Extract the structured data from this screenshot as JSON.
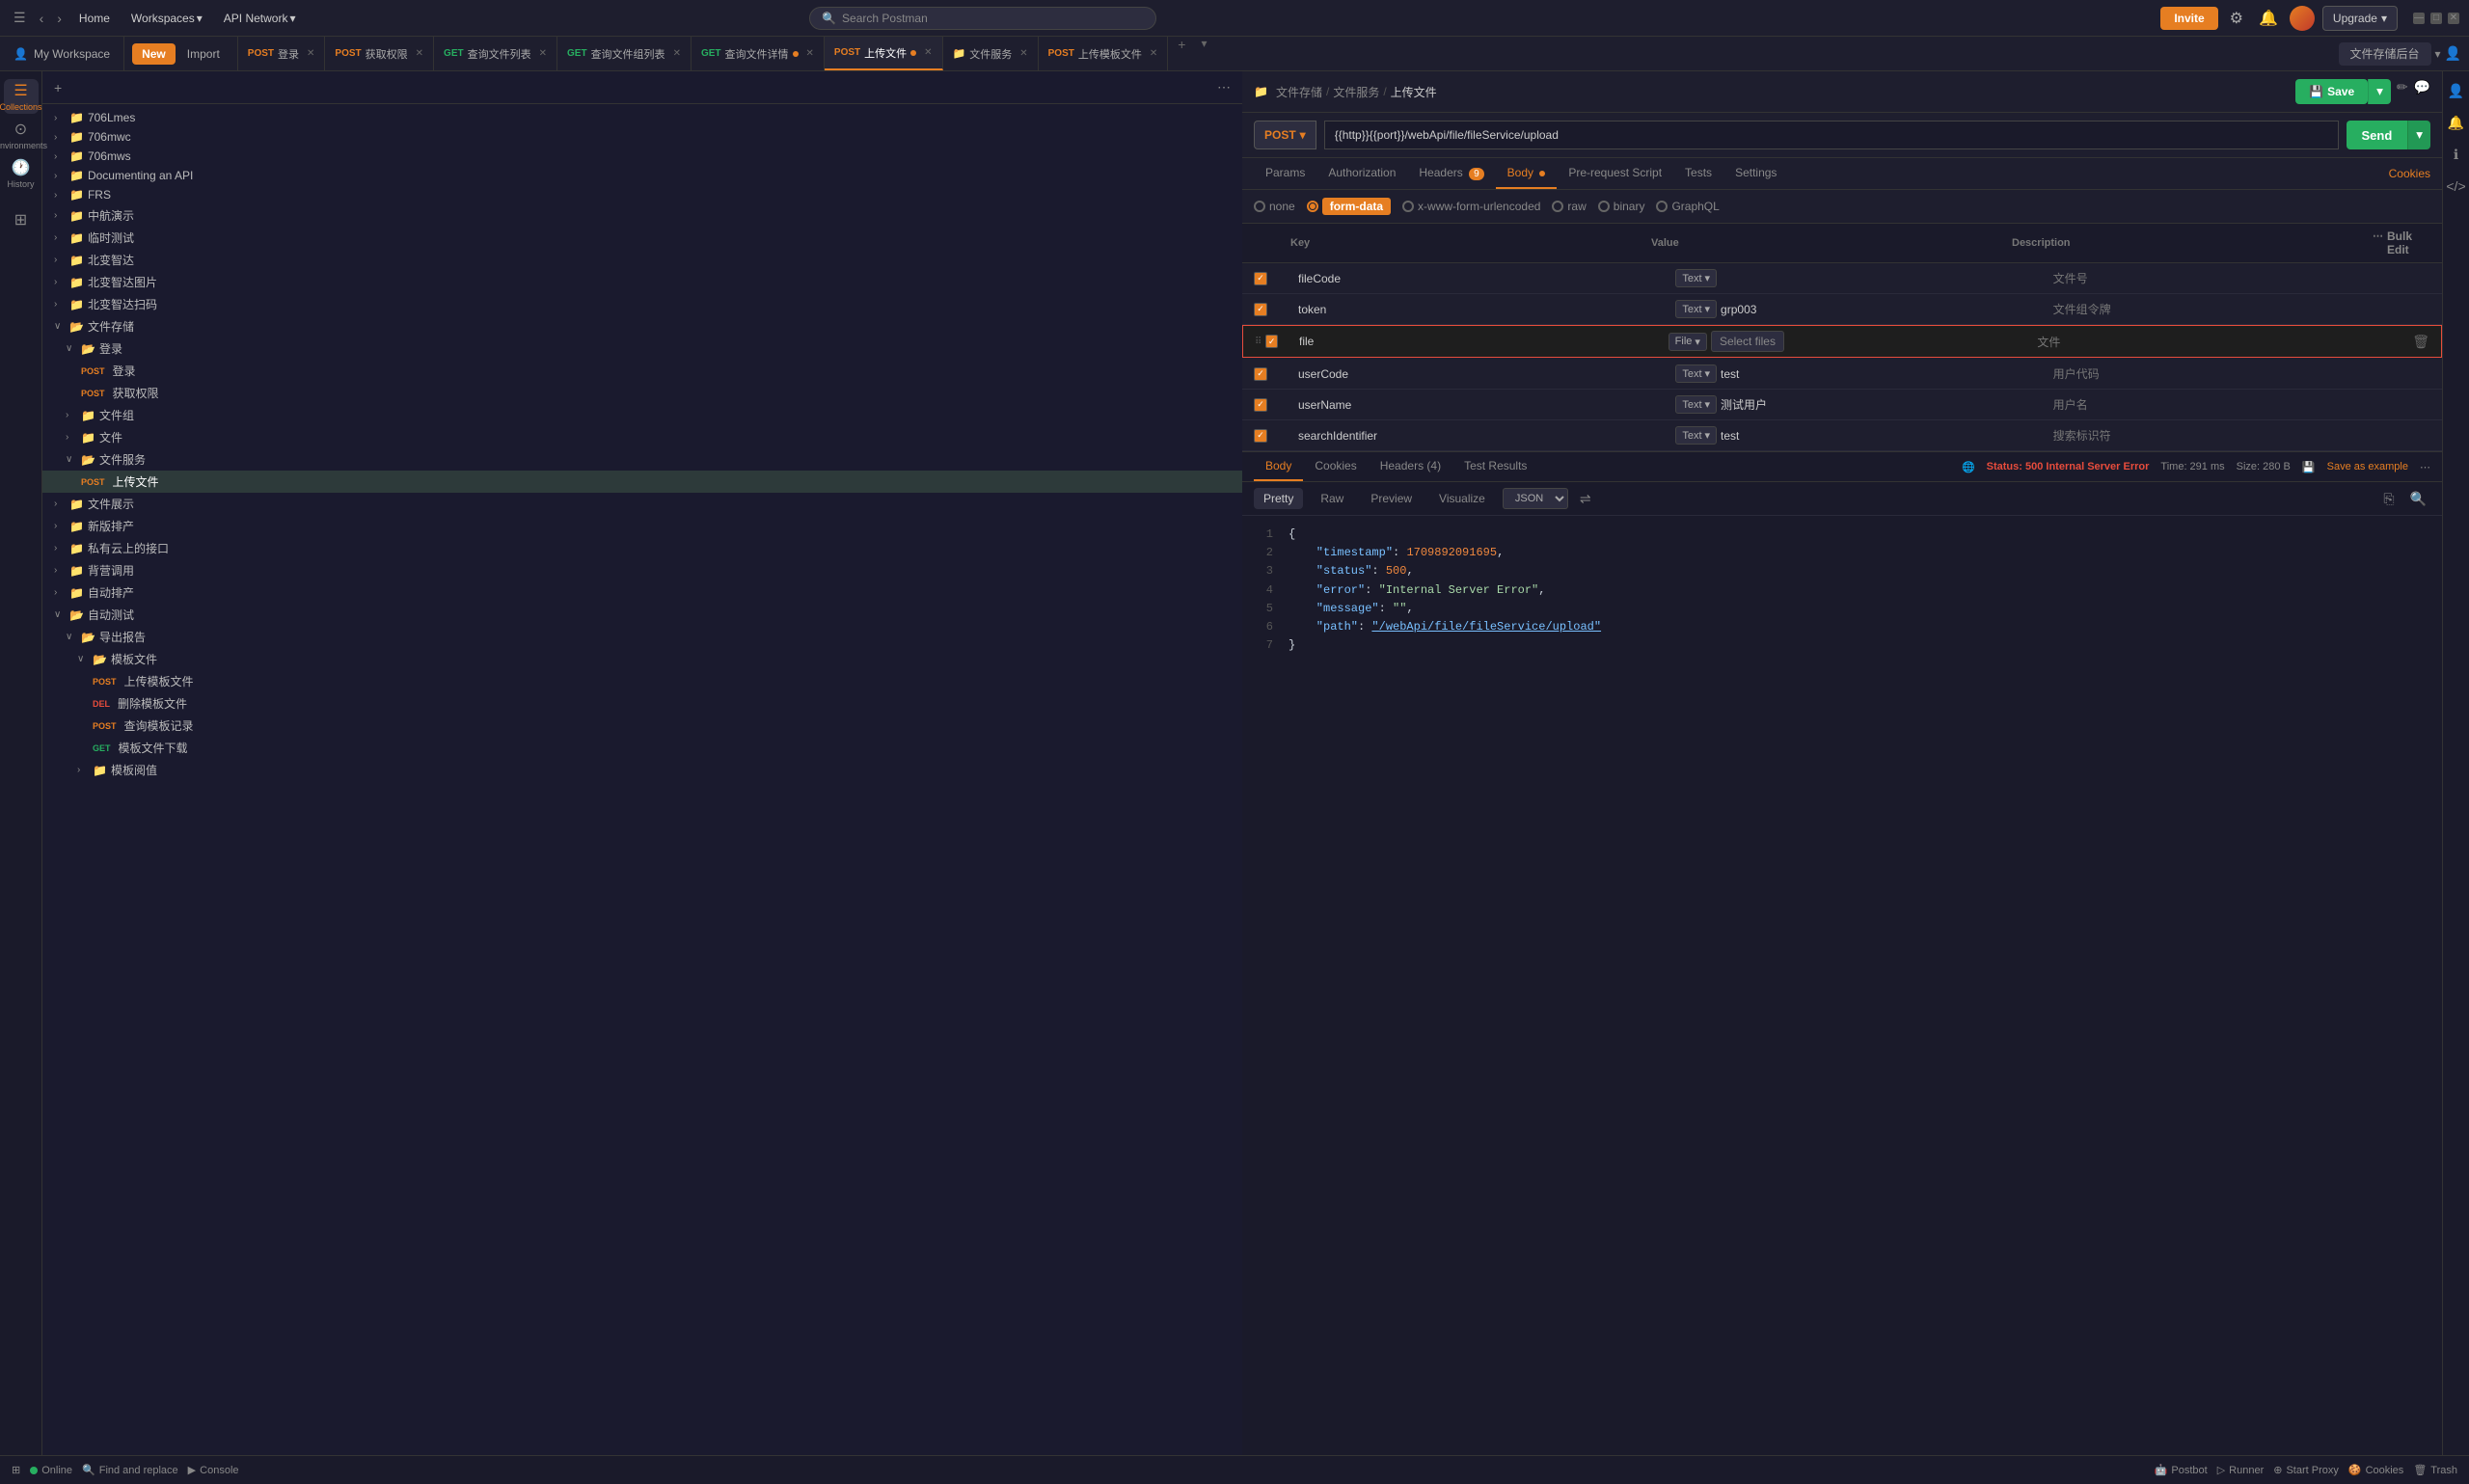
{
  "topbar": {
    "home": "Home",
    "workspaces": "Workspaces",
    "api_network": "API Network",
    "search_placeholder": "Search Postman",
    "invite_label": "Invite",
    "upgrade_label": "Upgrade"
  },
  "workspace": {
    "label": "My Workspace",
    "new_btn": "New",
    "import_btn": "Import"
  },
  "tabs": [
    {
      "method": "POST",
      "label": "登录",
      "type": "post"
    },
    {
      "method": "POST",
      "label": "获取权限",
      "type": "post"
    },
    {
      "method": "GET",
      "label": "查询文件列表",
      "type": "get"
    },
    {
      "method": "GET",
      "label": "查询文件组列表",
      "type": "get"
    },
    {
      "method": "GET",
      "label": "查询文件详情",
      "type": "get",
      "dot": true
    },
    {
      "method": "POST",
      "label": "上传文件",
      "type": "post",
      "dot": true,
      "active": true
    },
    {
      "method": "",
      "label": "文件服务",
      "type": "folder"
    },
    {
      "method": "POST",
      "label": "上传模板文件",
      "type": "post"
    }
  ],
  "workspace_name": "文件存储后台",
  "breadcrumb": {
    "icon": "📁",
    "parts": [
      "文件存储",
      "文件服务",
      "上传文件"
    ]
  },
  "request": {
    "method": "POST",
    "url": "{{http}}{{port}}/webApi/file/fileService/upload",
    "send": "Send"
  },
  "req_tabs": {
    "tabs": [
      "Params",
      "Authorization",
      "Headers (9)",
      "Body",
      "Pre-request Script",
      "Tests",
      "Settings"
    ],
    "active": "Body",
    "cookies_link": "Cookies"
  },
  "body_types": {
    "options": [
      "none",
      "form-data",
      "x-www-form-urlencoded",
      "raw",
      "binary",
      "GraphQL"
    ],
    "active": "form-data"
  },
  "params_table": {
    "headers": [
      "Key",
      "Value",
      "Description"
    ],
    "bulk_edit": "Bulk Edit",
    "rows": [
      {
        "key": "fileCode",
        "type": "Text",
        "value": "",
        "desc": "文件号",
        "checked": true,
        "highlighted": false
      },
      {
        "key": "token",
        "type": "Text",
        "value": "grp003",
        "desc": "文件组令牌",
        "checked": true,
        "highlighted": false
      },
      {
        "key": "file",
        "type": "File",
        "value": "Select files",
        "desc": "文件",
        "checked": true,
        "highlighted": true,
        "is_file": true
      },
      {
        "key": "userCode",
        "type": "Text",
        "value": "test",
        "desc": "用户代码",
        "checked": true,
        "highlighted": false
      },
      {
        "key": "userName",
        "type": "Text",
        "value": "测试用户",
        "desc": "用户名",
        "checked": true,
        "highlighted": false
      },
      {
        "key": "searchIdentifier",
        "type": "Text",
        "value": "test",
        "desc": "搜索标识符",
        "checked": true,
        "highlighted": false
      }
    ]
  },
  "response": {
    "tabs": [
      "Body",
      "Cookies",
      "Headers (4)",
      "Test Results"
    ],
    "active_tab": "Body",
    "status": "Status: 500 Internal Server Error",
    "time": "Time: 291 ms",
    "size": "Size: 280 B",
    "save_example": "Save as example"
  },
  "json_toolbar": {
    "tabs": [
      "Pretty",
      "Raw",
      "Preview",
      "Visualize"
    ],
    "active": "Pretty",
    "format": "JSON"
  },
  "json_content": {
    "lines": [
      {
        "num": 1,
        "content": "{"
      },
      {
        "num": 2,
        "content": "    \"timestamp\": 1709892091695,"
      },
      {
        "num": 3,
        "content": "    \"status\": 500,"
      },
      {
        "num": 4,
        "content": "    \"error\": \"Internal Server Error\","
      },
      {
        "num": 5,
        "content": "    \"message\": \"\","
      },
      {
        "num": 6,
        "content": "    \"path\": \"/webApi/file/fileService/upload\""
      },
      {
        "num": 7,
        "content": "}"
      }
    ]
  },
  "sidebar": {
    "collections_label": "Collections",
    "environments_label": "Environments",
    "history_label": "History",
    "items": [
      {
        "label": "706Lmes",
        "level": 0,
        "type": "folder",
        "expanded": false
      },
      {
        "label": "706mwc",
        "level": 0,
        "type": "folder",
        "expanded": false
      },
      {
        "label": "706mws",
        "level": 0,
        "type": "folder",
        "expanded": false
      },
      {
        "label": "Documenting an API",
        "level": 0,
        "type": "folder",
        "expanded": false
      },
      {
        "label": "FRS",
        "level": 0,
        "type": "folder",
        "expanded": false
      },
      {
        "label": "中航演示",
        "level": 0,
        "type": "folder",
        "expanded": false
      },
      {
        "label": "临时测试",
        "level": 0,
        "type": "folder",
        "expanded": false
      },
      {
        "label": "北变智达",
        "level": 0,
        "type": "folder",
        "expanded": false
      },
      {
        "label": "北变智达图片",
        "level": 0,
        "type": "folder",
        "expanded": false
      },
      {
        "label": "北变智达扫码",
        "level": 0,
        "type": "folder",
        "expanded": false
      },
      {
        "label": "文件存储",
        "level": 0,
        "type": "folder",
        "expanded": true
      },
      {
        "label": "登录",
        "level": 1,
        "type": "subfolder",
        "expanded": true
      },
      {
        "label": "登录",
        "level": 2,
        "type": "request",
        "method": "POST"
      },
      {
        "label": "获取权限",
        "level": 2,
        "type": "request",
        "method": "POST"
      },
      {
        "label": "文件组",
        "level": 1,
        "type": "subfolder",
        "expanded": false
      },
      {
        "label": "文件",
        "level": 1,
        "type": "subfolder",
        "expanded": false
      },
      {
        "label": "文件服务",
        "level": 1,
        "type": "subfolder",
        "expanded": true
      },
      {
        "label": "上传文件",
        "level": 2,
        "type": "request",
        "method": "POST",
        "active": true
      },
      {
        "label": "文件展示",
        "level": 0,
        "type": "folder",
        "expanded": false
      },
      {
        "label": "新版排产",
        "level": 0,
        "type": "folder",
        "expanded": false
      },
      {
        "label": "私有云上的接口",
        "level": 0,
        "type": "folder",
        "expanded": false
      },
      {
        "label": "背营调用",
        "level": 0,
        "type": "folder",
        "expanded": false
      },
      {
        "label": "自动排产",
        "level": 0,
        "type": "folder",
        "expanded": false
      },
      {
        "label": "自动测试",
        "level": 0,
        "type": "folder",
        "expanded": true
      },
      {
        "label": "导出报告",
        "level": 1,
        "type": "subfolder",
        "expanded": true
      },
      {
        "label": "模板文件",
        "level": 2,
        "type": "subfolder",
        "expanded": true
      },
      {
        "label": "上传模板文件",
        "level": 3,
        "type": "request",
        "method": "POST"
      },
      {
        "label": "删除模板文件",
        "level": 3,
        "type": "request",
        "method": "DEL"
      },
      {
        "label": "查询模板记录",
        "level": 3,
        "type": "request",
        "method": "POST"
      },
      {
        "label": "模板文件下载",
        "level": 3,
        "type": "request",
        "method": "GET"
      },
      {
        "label": "模板阅值",
        "level": 2,
        "type": "subfolder",
        "expanded": false
      }
    ]
  },
  "bottom_bar": {
    "online": "Online",
    "find_replace": "Find and replace",
    "console": "Console",
    "postbot": "Postbot",
    "runner": "Runner",
    "start_proxy": "Start Proxy",
    "cookies": "Cookies",
    "trash": "Trash"
  }
}
